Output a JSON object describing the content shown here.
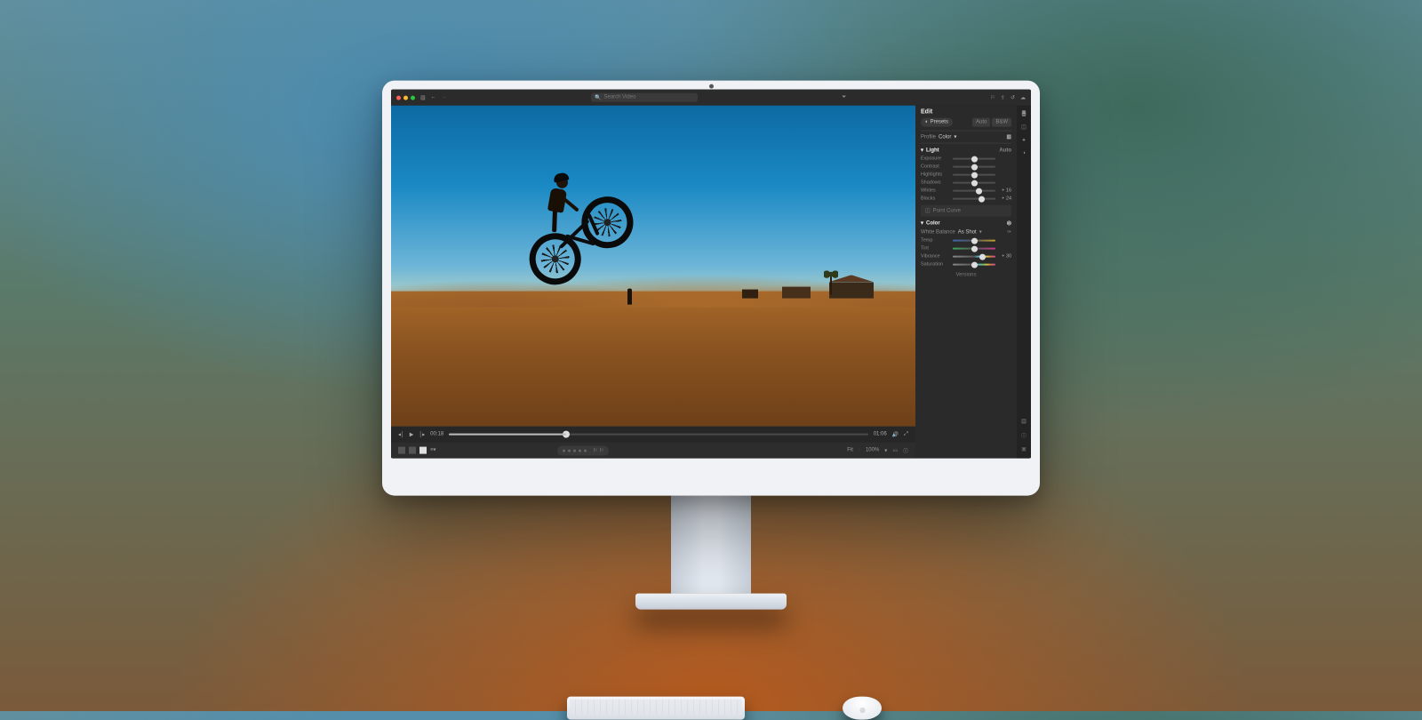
{
  "toolbar": {
    "search_placeholder": "Search Video",
    "filter_icon": "filter-icon",
    "right_icons": [
      "user-icon",
      "share-icon",
      "history-icon",
      "cloud-icon"
    ]
  },
  "playback": {
    "current_time": "00:18",
    "total_time": "01:06",
    "progress_pct": 28
  },
  "filmstrip": {
    "fit_label": "Fit",
    "zoom_pct": "100%"
  },
  "panel": {
    "title": "Edit",
    "presets_label": "Presets",
    "profile_label": "Profile",
    "profile_value": "Color",
    "auto_label": "Auto",
    "sections": {
      "light": {
        "title": "Light",
        "sliders": [
          {
            "label": "Exposure",
            "value": "",
            "pos": 50
          },
          {
            "label": "Contrast",
            "value": "",
            "pos": 50
          },
          {
            "label": "Highlights",
            "value": "",
            "pos": 50
          },
          {
            "label": "Shadows",
            "value": "",
            "pos": 50
          },
          {
            "label": "Whites",
            "value": "+ 16",
            "pos": 62
          },
          {
            "label": "Blacks",
            "value": "+ 24",
            "pos": 68
          }
        ],
        "curve_label": "Point Curve"
      },
      "color": {
        "title": "Color",
        "wb_label": "White Balance",
        "wb_value": "As Shot",
        "sliders": [
          {
            "label": "Temp",
            "value": "",
            "pos": 50,
            "grad": "grad1"
          },
          {
            "label": "Tint",
            "value": "",
            "pos": 50,
            "grad": "grad2"
          },
          {
            "label": "Vibrance",
            "value": "+ 30",
            "pos": 70,
            "grad": "grad3"
          },
          {
            "label": "Saturation",
            "value": "",
            "pos": 50,
            "grad": "grad3"
          }
        ]
      }
    },
    "versions_label": "Versions"
  }
}
